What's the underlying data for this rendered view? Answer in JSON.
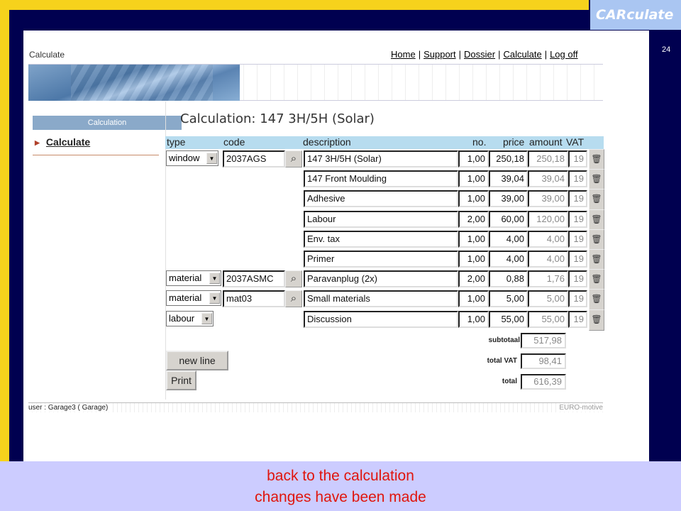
{
  "slide": {
    "logo": "CARculate",
    "page_number": "24",
    "caption_line1": "back to the calculation",
    "caption_line2": "changes have been made"
  },
  "app": {
    "title": "Calculate",
    "nav": [
      "Home",
      "Support",
      "Dossier",
      "Calculate",
      "Log off"
    ]
  },
  "sidebar": {
    "header": "Calculation",
    "item": "Calculate"
  },
  "main": {
    "title": "Calculation: 147 3H/5H (Solar)",
    "columns": [
      "type",
      "code",
      "description",
      "no.",
      "price",
      "amount",
      "VAT"
    ],
    "rows": [
      {
        "type": "window",
        "code": "2037AGS",
        "description": "147 3H/5H     (Solar)",
        "no": "1,00",
        "price": "250,18",
        "amount": "250,18",
        "vat": "19"
      },
      {
        "type": "",
        "code": "",
        "description": "147 Front Moulding",
        "no": "1,00",
        "price": "39,04",
        "amount": "39,04",
        "vat": "19"
      },
      {
        "type": "",
        "code": "",
        "description": "Adhesive",
        "no": "1,00",
        "price": "39,00",
        "amount": "39,00",
        "vat": "19"
      },
      {
        "type": "",
        "code": "",
        "description": "Labour",
        "no": "2,00",
        "price": "60,00",
        "amount": "120,00",
        "vat": "19"
      },
      {
        "type": "",
        "code": "",
        "description": "Env. tax",
        "no": "1,00",
        "price": "4,00",
        "amount": "4,00",
        "vat": "19"
      },
      {
        "type": "",
        "code": "",
        "description": "Primer",
        "no": "1,00",
        "price": "4,00",
        "amount": "4,00",
        "vat": "19"
      },
      {
        "type": "material",
        "code": "2037ASMC",
        "description": "Paravanplug (2x)",
        "no": "2,00",
        "price": "0,88",
        "amount": "1,76",
        "vat": "19"
      },
      {
        "type": "material",
        "code": "mat03",
        "description": "Small materials",
        "no": "1,00",
        "price": "5,00",
        "amount": "5,00",
        "vat": "19"
      },
      {
        "type": "labour",
        "code": "",
        "description": "Discussion",
        "no": "1,00",
        "price": "55,00",
        "amount": "55,00",
        "vat": "19"
      }
    ],
    "totals": {
      "subtotal_label": "subtotaal",
      "subtotal": "517,98",
      "vat_label": "total VAT",
      "vat": "98,41",
      "total_label": "total",
      "total": "616,39"
    },
    "new_line_label": "new line",
    "print_label": "Print"
  },
  "status": {
    "user": "user : Garage3 ( Garage)",
    "brand": "EURO-motive"
  }
}
